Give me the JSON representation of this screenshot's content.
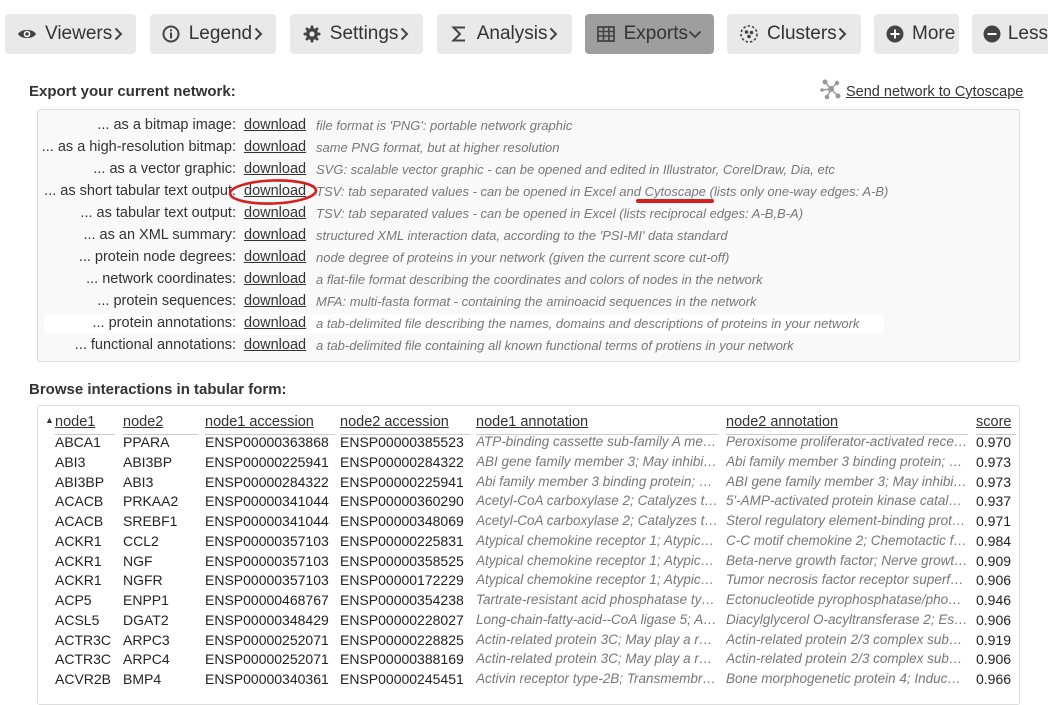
{
  "tabs": [
    {
      "label": "Viewers",
      "icon": "eye-icon",
      "active": false
    },
    {
      "label": "Legend",
      "icon": "info-icon",
      "active": false
    },
    {
      "label": "Settings",
      "icon": "gear-icon",
      "active": false
    },
    {
      "label": "Analysis",
      "icon": "sigma-icon",
      "active": false
    },
    {
      "label": "Exports",
      "icon": "table-icon",
      "active": true
    },
    {
      "label": "Clusters",
      "icon": "clusters-icon",
      "active": false
    },
    {
      "label": "More",
      "icon": "plus-circle-icon",
      "active": false
    },
    {
      "label": "Less",
      "icon": "minus-circle-icon",
      "active": false
    }
  ],
  "export": {
    "heading": "Export your current network:",
    "cytoscape_link": "Send network to Cytoscape",
    "rows": [
      {
        "label": "... as a bitmap image:",
        "link": "download",
        "desc": "file format is 'PNG': portable network graphic"
      },
      {
        "label": "... as a high-resolution bitmap:",
        "link": "download",
        "desc": "same PNG format, but at higher resolution"
      },
      {
        "label": "... as a vector graphic:",
        "link": "download",
        "desc": "SVG: scalable vector graphic - can be opened and edited in Illustrator, CorelDraw, Dia, etc"
      },
      {
        "label": "... as short tabular text output:",
        "link": "download",
        "desc": "TSV: tab separated values - can be opened in Excel and Cytoscape (lists only one-way edges: A-B)"
      },
      {
        "label": "... as tabular text output:",
        "link": "download",
        "desc": "TSV: tab separated values - can be opened in Excel (lists reciprocal edges: A-B,B-A)"
      },
      {
        "label": "... as an XML summary:",
        "link": "download",
        "desc": "structured XML interaction data, according to the 'PSI-MI' data standard"
      },
      {
        "label": "... protein node degrees:",
        "link": "download",
        "desc": "node degree of proteins in your network (given the current score cut-off)"
      },
      {
        "label": "... network coordinates:",
        "link": "download",
        "desc": "a flat-file format describing the coordinates and colors of nodes in the network"
      },
      {
        "label": "... protein sequences:",
        "link": "download",
        "desc": "MFA: multi-fasta format - containing the aminoacid sequences in the network"
      },
      {
        "label": "... protein annotations:",
        "link": "download",
        "desc": "a tab-delimited file describing the names, domains and descriptions of proteins in your network"
      },
      {
        "label": "... functional annotations:",
        "link": "download",
        "desc": "a tab-delimited file containing all known functional terms of protiens in your network"
      }
    ]
  },
  "browse": {
    "heading": "Browse interactions in tabular form:",
    "columns": [
      "node1",
      "node2",
      "node1 accession",
      "node2 accession",
      "node1 annotation",
      "node2 annotation",
      "score"
    ],
    "rows": [
      [
        "ABCA1",
        "PPARA",
        "ENSP00000363868",
        "ENSP00000385523",
        "ATP-binding cassette sub-family A me…",
        "Peroxisome proliferator-activated rece…",
        "0.970"
      ],
      [
        "ABI3",
        "ABI3BP",
        "ENSP00000225941",
        "ENSP00000284322",
        "ABI gene family member 3; May inhibit …",
        "Abi family member 3 binding protein; T…",
        "0.973"
      ],
      [
        "ABI3BP",
        "ABI3",
        "ENSP00000284322",
        "ENSP00000225941",
        "Abi family member 3 binding protein; T…",
        "ABI gene family member 3; May inhibit …",
        "0.973"
      ],
      [
        "ACACB",
        "PRKAA2",
        "ENSP00000341044",
        "ENSP00000360290",
        "Acetyl-CoA carboxylase 2; Catalyzes th…",
        "5'-AMP-activated protein kinase catalyt…",
        "0.937"
      ],
      [
        "ACACB",
        "SREBF1",
        "ENSP00000341044",
        "ENSP00000348069",
        "Acetyl-CoA carboxylase 2; Catalyzes th…",
        "Sterol regulatory element-binding prote…",
        "0.971"
      ],
      [
        "ACKR1",
        "CCL2",
        "ENSP00000357103",
        "ENSP00000225831",
        "Atypical chemokine receptor 1; Atypica…",
        "C-C motif chemokine 2; Chemotactic fa…",
        "0.984"
      ],
      [
        "ACKR1",
        "NGF",
        "ENSP00000357103",
        "ENSP00000358525",
        "Atypical chemokine receptor 1; Atypica…",
        "Beta-nerve growth factor; Nerve growth…",
        "0.909"
      ],
      [
        "ACKR1",
        "NGFR",
        "ENSP00000357103",
        "ENSP00000172229",
        "Atypical chemokine receptor 1; Atypica…",
        "Tumor necrosis factor receptor superfa…",
        "0.906"
      ],
      [
        "ACP5",
        "ENPP1",
        "ENSP00000468767",
        "ENSP00000354238",
        "Tartrate-resistant acid phosphatase typ…",
        "Ectonucleotide pyrophosphatase/phos…",
        "0.946"
      ],
      [
        "ACSL5",
        "DGAT2",
        "ENSP00000348429",
        "ENSP00000228027",
        "Long-chain-fatty-acid--CoA ligase 5; Ac…",
        "Diacylglycerol O-acyltransferase 2; Ess…",
        "0.906"
      ],
      [
        "ACTR3C",
        "ARPC3",
        "ENSP00000252071",
        "ENSP00000228825",
        "Actin-related protein 3C; May play a rol…",
        "Actin-related protein 2/3 complex subu…",
        "0.919"
      ],
      [
        "ACTR3C",
        "ARPC4",
        "ENSP00000252071",
        "ENSP00000388169",
        "Actin-related protein 3C; May play a rol…",
        "Actin-related protein 2/3 complex subu…",
        "0.906"
      ],
      [
        "ACVR2B",
        "BMP4",
        "ENSP00000340361",
        "ENSP00000245451",
        "Activin receptor type-2B; Transmembra…",
        "Bone morphogenetic protein 4; Induces…",
        "0.966"
      ]
    ]
  },
  "colors": {
    "tab_bg": "#e9e9e9",
    "tab_active_bg": "#9e9e9e",
    "annotation_red": "#d62020"
  }
}
